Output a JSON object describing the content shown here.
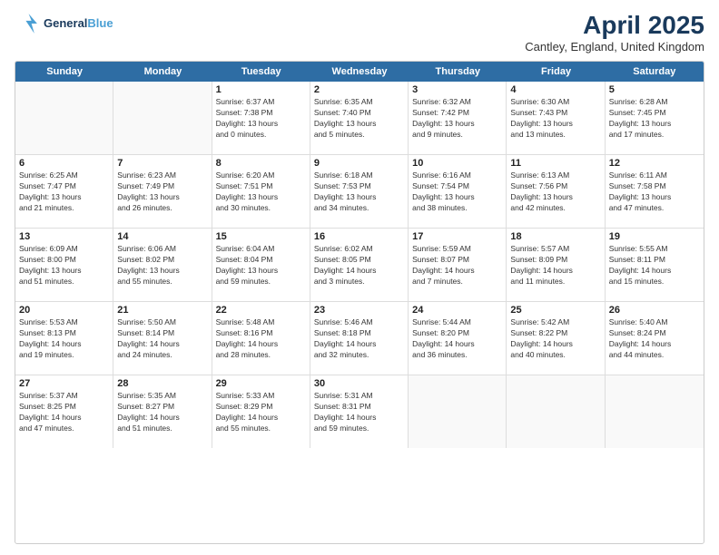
{
  "logo": {
    "line1": "General",
    "line2": "Blue"
  },
  "title": "April 2025",
  "location": "Cantley, England, United Kingdom",
  "days_of_week": [
    "Sunday",
    "Monday",
    "Tuesday",
    "Wednesday",
    "Thursday",
    "Friday",
    "Saturday"
  ],
  "weeks": [
    [
      {
        "day": "",
        "content": ""
      },
      {
        "day": "",
        "content": ""
      },
      {
        "day": "1",
        "content": "Sunrise: 6:37 AM\nSunset: 7:38 PM\nDaylight: 13 hours\nand 0 minutes."
      },
      {
        "day": "2",
        "content": "Sunrise: 6:35 AM\nSunset: 7:40 PM\nDaylight: 13 hours\nand 5 minutes."
      },
      {
        "day": "3",
        "content": "Sunrise: 6:32 AM\nSunset: 7:42 PM\nDaylight: 13 hours\nand 9 minutes."
      },
      {
        "day": "4",
        "content": "Sunrise: 6:30 AM\nSunset: 7:43 PM\nDaylight: 13 hours\nand 13 minutes."
      },
      {
        "day": "5",
        "content": "Sunrise: 6:28 AM\nSunset: 7:45 PM\nDaylight: 13 hours\nand 17 minutes."
      }
    ],
    [
      {
        "day": "6",
        "content": "Sunrise: 6:25 AM\nSunset: 7:47 PM\nDaylight: 13 hours\nand 21 minutes."
      },
      {
        "day": "7",
        "content": "Sunrise: 6:23 AM\nSunset: 7:49 PM\nDaylight: 13 hours\nand 26 minutes."
      },
      {
        "day": "8",
        "content": "Sunrise: 6:20 AM\nSunset: 7:51 PM\nDaylight: 13 hours\nand 30 minutes."
      },
      {
        "day": "9",
        "content": "Sunrise: 6:18 AM\nSunset: 7:53 PM\nDaylight: 13 hours\nand 34 minutes."
      },
      {
        "day": "10",
        "content": "Sunrise: 6:16 AM\nSunset: 7:54 PM\nDaylight: 13 hours\nand 38 minutes."
      },
      {
        "day": "11",
        "content": "Sunrise: 6:13 AM\nSunset: 7:56 PM\nDaylight: 13 hours\nand 42 minutes."
      },
      {
        "day": "12",
        "content": "Sunrise: 6:11 AM\nSunset: 7:58 PM\nDaylight: 13 hours\nand 47 minutes."
      }
    ],
    [
      {
        "day": "13",
        "content": "Sunrise: 6:09 AM\nSunset: 8:00 PM\nDaylight: 13 hours\nand 51 minutes."
      },
      {
        "day": "14",
        "content": "Sunrise: 6:06 AM\nSunset: 8:02 PM\nDaylight: 13 hours\nand 55 minutes."
      },
      {
        "day": "15",
        "content": "Sunrise: 6:04 AM\nSunset: 8:04 PM\nDaylight: 13 hours\nand 59 minutes."
      },
      {
        "day": "16",
        "content": "Sunrise: 6:02 AM\nSunset: 8:05 PM\nDaylight: 14 hours\nand 3 minutes."
      },
      {
        "day": "17",
        "content": "Sunrise: 5:59 AM\nSunset: 8:07 PM\nDaylight: 14 hours\nand 7 minutes."
      },
      {
        "day": "18",
        "content": "Sunrise: 5:57 AM\nSunset: 8:09 PM\nDaylight: 14 hours\nand 11 minutes."
      },
      {
        "day": "19",
        "content": "Sunrise: 5:55 AM\nSunset: 8:11 PM\nDaylight: 14 hours\nand 15 minutes."
      }
    ],
    [
      {
        "day": "20",
        "content": "Sunrise: 5:53 AM\nSunset: 8:13 PM\nDaylight: 14 hours\nand 19 minutes."
      },
      {
        "day": "21",
        "content": "Sunrise: 5:50 AM\nSunset: 8:14 PM\nDaylight: 14 hours\nand 24 minutes."
      },
      {
        "day": "22",
        "content": "Sunrise: 5:48 AM\nSunset: 8:16 PM\nDaylight: 14 hours\nand 28 minutes."
      },
      {
        "day": "23",
        "content": "Sunrise: 5:46 AM\nSunset: 8:18 PM\nDaylight: 14 hours\nand 32 minutes."
      },
      {
        "day": "24",
        "content": "Sunrise: 5:44 AM\nSunset: 8:20 PM\nDaylight: 14 hours\nand 36 minutes."
      },
      {
        "day": "25",
        "content": "Sunrise: 5:42 AM\nSunset: 8:22 PM\nDaylight: 14 hours\nand 40 minutes."
      },
      {
        "day": "26",
        "content": "Sunrise: 5:40 AM\nSunset: 8:24 PM\nDaylight: 14 hours\nand 44 minutes."
      }
    ],
    [
      {
        "day": "27",
        "content": "Sunrise: 5:37 AM\nSunset: 8:25 PM\nDaylight: 14 hours\nand 47 minutes."
      },
      {
        "day": "28",
        "content": "Sunrise: 5:35 AM\nSunset: 8:27 PM\nDaylight: 14 hours\nand 51 minutes."
      },
      {
        "day": "29",
        "content": "Sunrise: 5:33 AM\nSunset: 8:29 PM\nDaylight: 14 hours\nand 55 minutes."
      },
      {
        "day": "30",
        "content": "Sunrise: 5:31 AM\nSunset: 8:31 PM\nDaylight: 14 hours\nand 59 minutes."
      },
      {
        "day": "",
        "content": ""
      },
      {
        "day": "",
        "content": ""
      },
      {
        "day": "",
        "content": ""
      }
    ]
  ]
}
